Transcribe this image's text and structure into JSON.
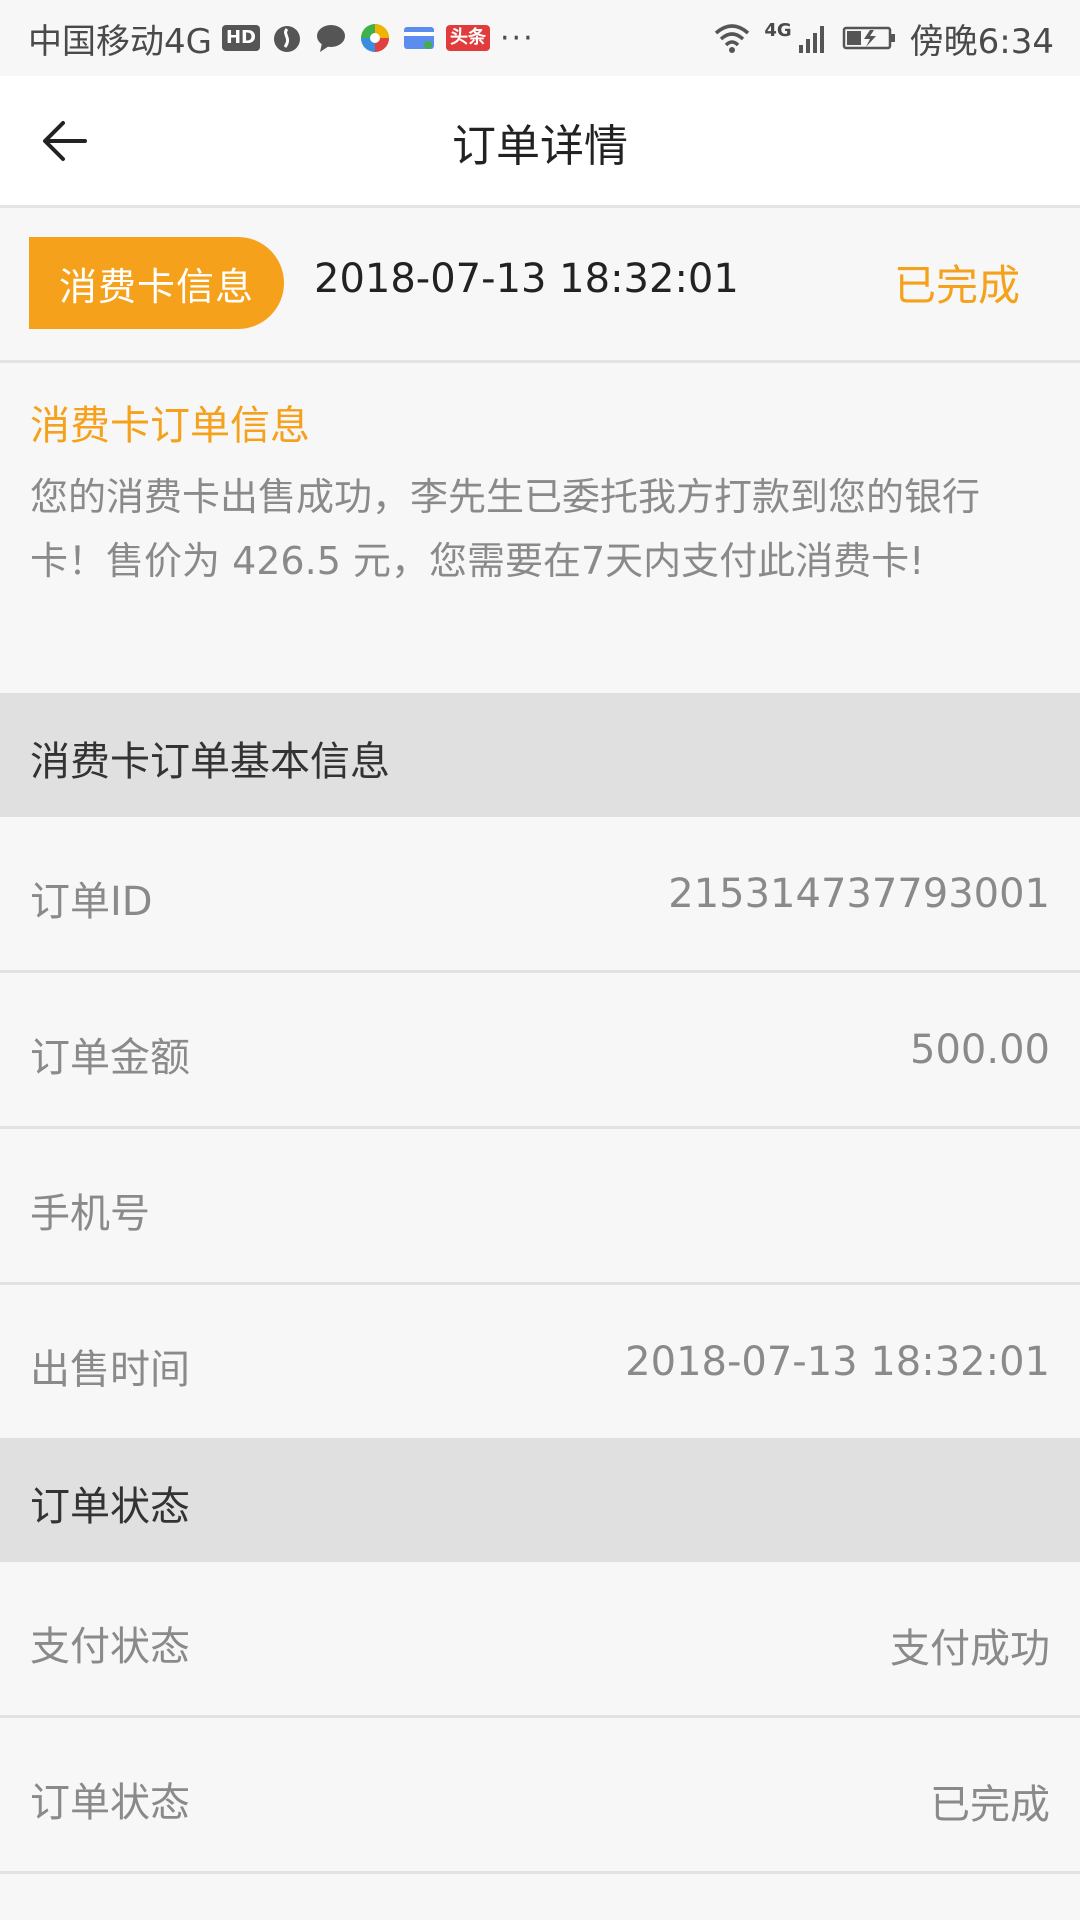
{
  "status_bar": {
    "carrier": "中国移动4G",
    "hd_badge": "HD",
    "news_badge": "头条",
    "more": "···",
    "network": "4G",
    "time": "傍晚6:34",
    "icons": [
      "fire-icon",
      "chat-bubble-icon",
      "pinwheel-icon",
      "card-icon",
      "news-icon",
      "wifi-icon",
      "signal-icon",
      "battery-icon"
    ]
  },
  "header": {
    "title": "订单详情",
    "back_icon": "arrow-left-icon"
  },
  "card_row": {
    "badge": "消费卡信息",
    "date": "2018-07-13 18:32:01",
    "status": "已完成"
  },
  "info": {
    "title": "消费卡订单信息",
    "text": "您的消费卡出售成功，李先生已委托我方打款到您的银行卡！售价为 426.5 元，您需要在7天内支付此消费卡!"
  },
  "basic_section": {
    "title": "消费卡订单基本信息",
    "rows": [
      {
        "label": "订单ID",
        "value": "215314737793001"
      },
      {
        "label": "订单金额",
        "value": "500.00"
      },
      {
        "label": "手机号",
        "value": ""
      },
      {
        "label": "出售时间",
        "value": "2018-07-13 18:32:01"
      }
    ]
  },
  "status_section": {
    "title": "订单状态",
    "rows": [
      {
        "label": "支付状态",
        "value": "支付成功"
      },
      {
        "label": "订单状态",
        "value": "已完成"
      }
    ]
  },
  "colors": {
    "accent": "#f5a11c",
    "section_bg": "#e0e0e0",
    "page_bg": "#f7f7f7"
  }
}
